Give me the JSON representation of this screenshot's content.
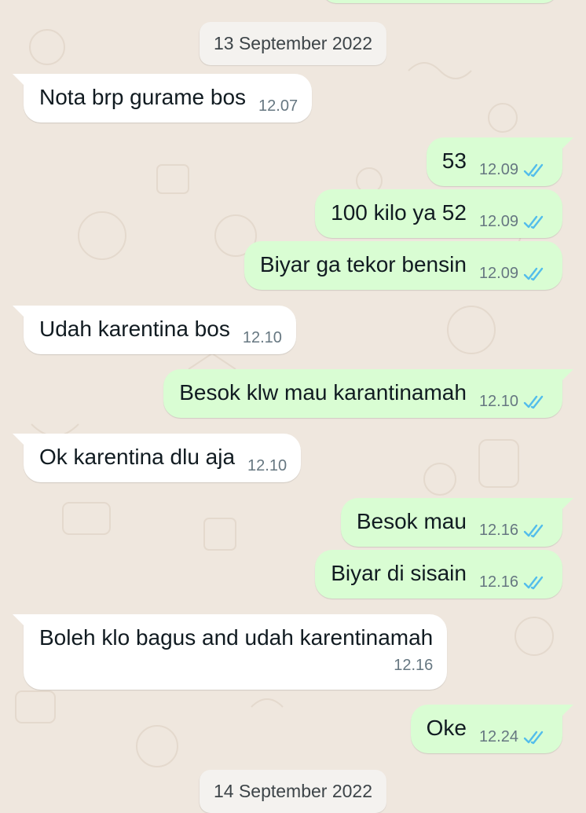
{
  "chat": {
    "date_1": "13 September 2022",
    "date_2": "14 September 2022",
    "messages": [
      {
        "dir": "in",
        "text": "Nota brp gurame bos",
        "time": "12.07"
      },
      {
        "dir": "out",
        "text": "53",
        "time": "12.09",
        "status": "read"
      },
      {
        "dir": "out",
        "text": "100 kilo ya 52",
        "time": "12.09",
        "status": "read"
      },
      {
        "dir": "out",
        "text": "Biyar ga tekor bensin",
        "time": "12.09",
        "status": "read"
      },
      {
        "dir": "in",
        "text": "Udah karentina bos",
        "time": "12.10"
      },
      {
        "dir": "out",
        "text": "Besok klw mau karantinamah",
        "time": "12.10",
        "status": "read"
      },
      {
        "dir": "in",
        "text": "Ok karentina dlu aja",
        "time": "12.10"
      },
      {
        "dir": "out",
        "text": "Besok mau",
        "time": "12.16",
        "status": "read"
      },
      {
        "dir": "out",
        "text": "Biyar di sisain",
        "time": "12.16",
        "status": "read"
      },
      {
        "dir": "in",
        "text": "Boleh klo bagus and udah karentinamah",
        "time": "12.16"
      },
      {
        "dir": "out",
        "text": "Oke",
        "time": "12.24",
        "status": "read"
      }
    ]
  },
  "colors": {
    "background": "#efe7de",
    "incoming_bubble": "#ffffff",
    "outgoing_bubble": "#d9fdd3",
    "read_ticks": "#53bdeb"
  },
  "icons": {
    "read_receipt": "double-check-icon"
  }
}
